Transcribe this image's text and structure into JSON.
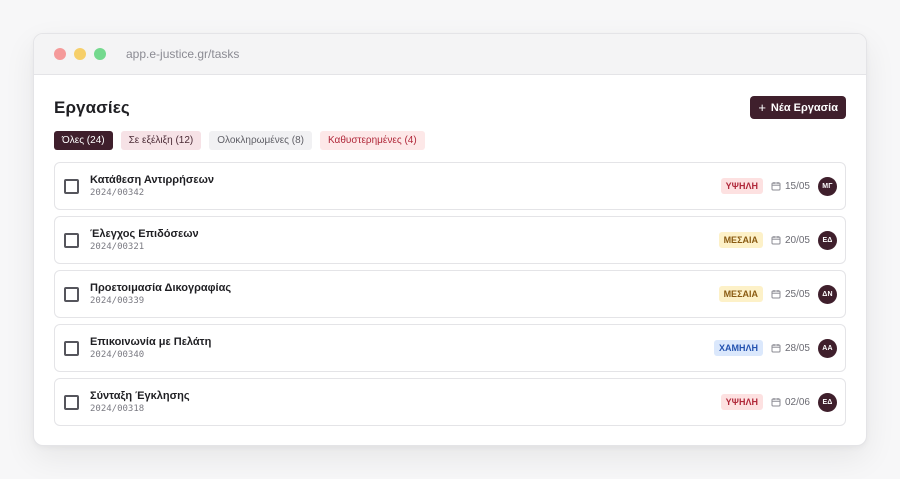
{
  "window": {
    "url": "app.e-justice.gr/tasks"
  },
  "page": {
    "title": "Εργασίες",
    "new_button": {
      "icon": "plus-icon",
      "label": "Νέα Εργασία"
    }
  },
  "filters": [
    {
      "label": "Όλες (24)",
      "active": true
    },
    {
      "label": "Σε εξέλιξη (12)"
    },
    {
      "label": "Ολοκληρωμένες (8)"
    },
    {
      "label": "Καθυστερημένες (4)"
    }
  ],
  "tasks": [
    {
      "title": "Κατάθεση Αντιρρήσεων",
      "code": "2024/00342",
      "priority": "ΥΨΗΛΗ",
      "date": "15/05",
      "assignee": "ΜΓ"
    },
    {
      "title": "Έλεγχος Επιδόσεων",
      "code": "2024/00321",
      "priority": "ΜΕΣΑΙΑ",
      "date": "20/05",
      "assignee": "ΕΔ"
    },
    {
      "title": "Προετοιμασία Δικογραφίας",
      "code": "2024/00339",
      "priority": "ΜΕΣΑΙΑ",
      "date": "25/05",
      "assignee": "ΔΝ"
    },
    {
      "title": "Επικοινωνία με Πελάτη",
      "code": "2024/00340",
      "priority": "ΧΑΜΗΛΗ",
      "date": "28/05",
      "assignee": "ΑΑ"
    },
    {
      "title": "Σύνταξη Έγκλησης",
      "code": "2024/00318",
      "priority": "ΥΨΗΛΗ",
      "date": "02/06",
      "assignee": "ΕΔ"
    }
  ],
  "colors": {
    "brand": "#3f1f2c",
    "priority_high": "#b0283a",
    "priority_medium": "#8a5b12",
    "priority_low": "#2453b0"
  }
}
